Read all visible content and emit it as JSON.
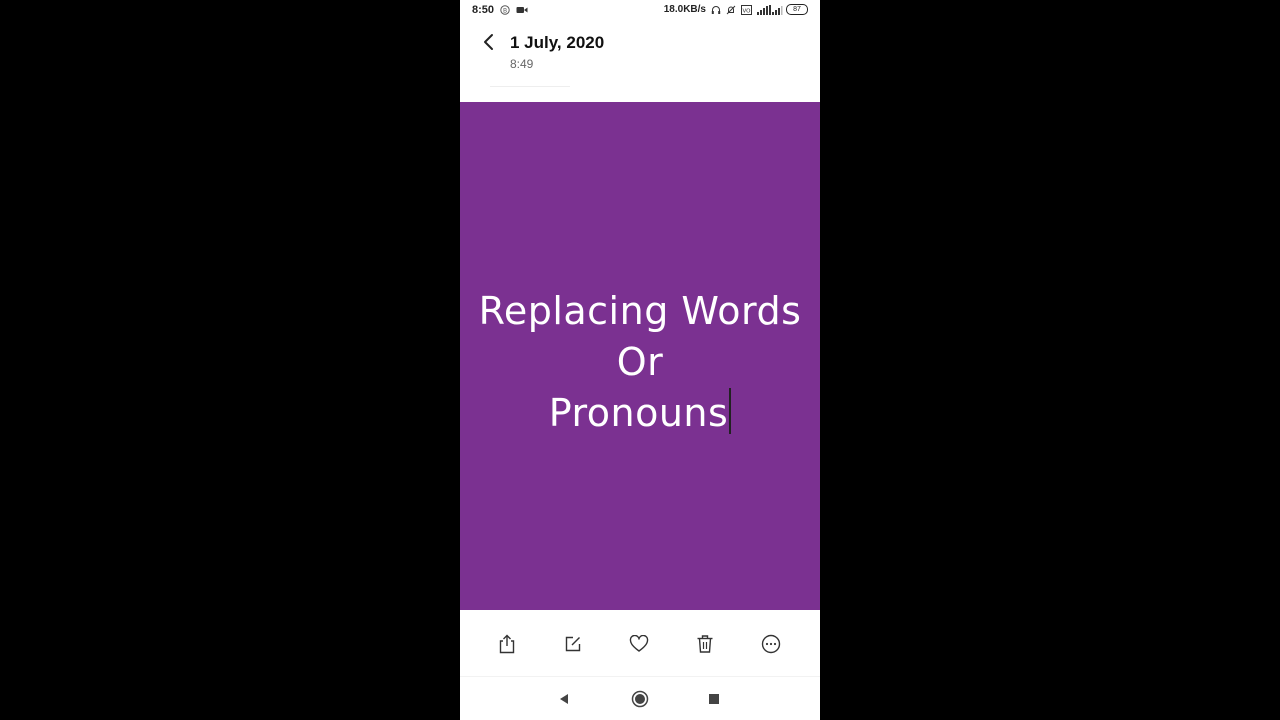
{
  "status_bar": {
    "time": "8:50",
    "net_speed": "18.0KB/s",
    "battery_level": "87",
    "icons": [
      "notification-b-icon",
      "video-icon",
      "headphones-icon",
      "mute-bell-icon",
      "vo-icon",
      "signal-4g-icon",
      "signal-icon"
    ]
  },
  "header": {
    "title": "1 July, 2020",
    "subtitle": "8:49"
  },
  "image": {
    "background_color": "#7b3191",
    "text_color": "#ffffff",
    "lines": [
      "Replacing Words",
      "Or",
      "Pronouns"
    ]
  },
  "toolbar": {
    "icons": [
      "share-icon",
      "edit-icon",
      "heart-icon",
      "trash-icon",
      "more-icon"
    ]
  },
  "nav": {
    "icons": [
      "back-triangle-icon",
      "home-circle-icon",
      "recents-square-icon"
    ]
  }
}
